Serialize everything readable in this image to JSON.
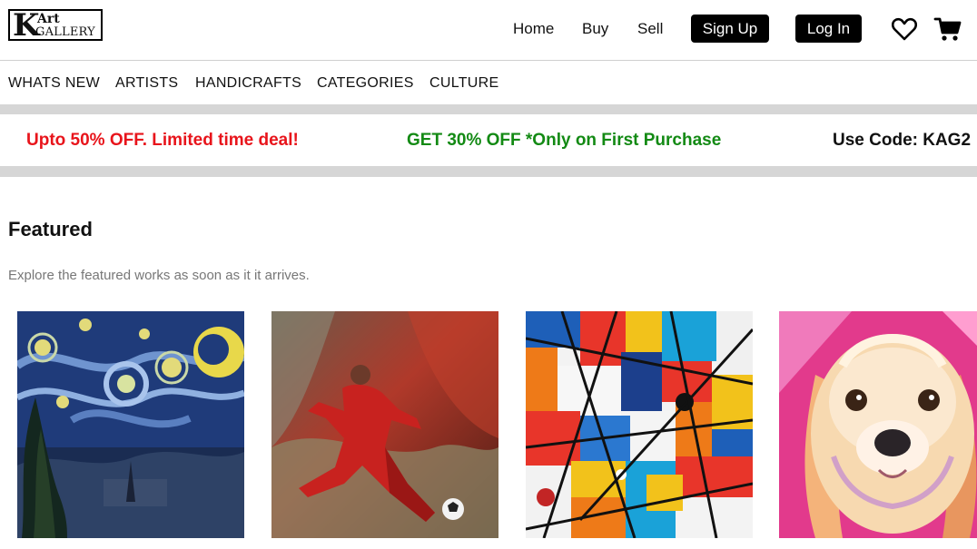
{
  "brand": {
    "logo_k": "K",
    "logo_art": "Art",
    "logo_gallery": "GALLERY"
  },
  "nav": {
    "home": "Home",
    "buy": "Buy",
    "sell": "Sell",
    "sign_up": "Sign Up",
    "log_in": "Log In",
    "wishlist_icon": "heart-icon",
    "cart_icon": "cart-icon"
  },
  "categories": [
    "WHATS NEW",
    "ARTISTS",
    "HANDICRAFTS",
    "CATEGORIES",
    "CULTURE"
  ],
  "promo": {
    "items": [
      "Upto 50% OFF. Limited time deal!",
      "GET 30% OFF *Only on First Purchase",
      "Use Code: KAG2"
    ],
    "colors": [
      "#e8141b",
      "#138a14",
      "#111111"
    ]
  },
  "featured": {
    "title": "Featured",
    "subtitle": "Explore the featured works as soon as it it arrives."
  },
  "colors": {
    "accent": "#000000",
    "divider": "#d6d6d6"
  }
}
